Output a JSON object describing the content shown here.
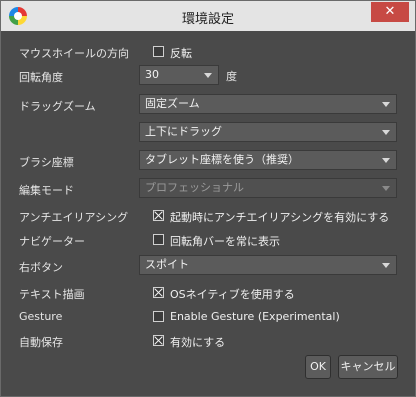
{
  "window": {
    "title": "環境設定",
    "close_glyph": "✕",
    "app_icon": "color-wheel-icon"
  },
  "settings": {
    "wheel_direction": {
      "label": "マウスホイールの方向",
      "option": "反転",
      "checked": false
    },
    "rotation_angle": {
      "label": "回転角度",
      "value": "30",
      "unit": "度"
    },
    "drag_zoom": {
      "label": "ドラッグズーム",
      "value": "固定ズーム",
      "value2": "上下にドラッグ"
    },
    "brush_coordinates": {
      "label": "ブラシ座標",
      "value": "タブレット座標を使う（推奨）"
    },
    "edit_mode": {
      "label": "編集モード",
      "value": "プロフェッショナル",
      "disabled": true
    },
    "antialiasing": {
      "label": "アンチエイリアシング",
      "option": "起動時にアンチエイリアシングを有効にする",
      "checked": true
    },
    "navigator": {
      "label": "ナビゲーター",
      "option": "回転角バーを常に表示",
      "checked": false
    },
    "right_button": {
      "label": "右ボタン",
      "value": "スポイト"
    },
    "text_rendering": {
      "label": "テキスト描画",
      "option": "OSネイティブを使用する",
      "checked": true
    },
    "gesture": {
      "label": "Gesture",
      "option": "Enable Gesture (Experimental)",
      "checked": false
    },
    "autosave": {
      "label": "自動保存",
      "option": "有効にする",
      "checked": true
    }
  },
  "buttons": {
    "ok": "OK",
    "cancel": "キャンセル"
  }
}
